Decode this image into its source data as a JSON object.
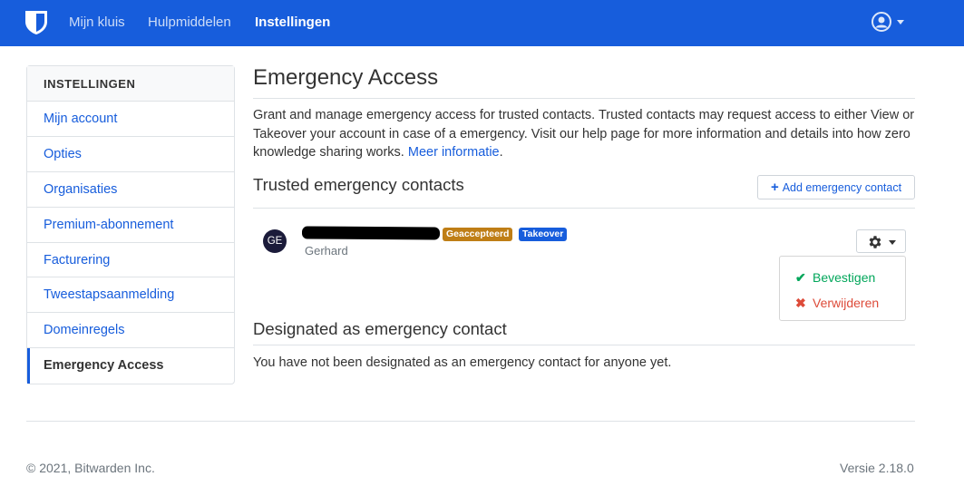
{
  "nav": {
    "items": [
      {
        "label": "Mijn kluis"
      },
      {
        "label": "Hulpmiddelen"
      },
      {
        "label": "Instellingen"
      }
    ]
  },
  "sidebar": {
    "header": "INSTELLINGEN",
    "items": [
      {
        "label": "Mijn account"
      },
      {
        "label": "Opties"
      },
      {
        "label": "Organisaties"
      },
      {
        "label": "Premium-abonnement"
      },
      {
        "label": "Facturering"
      },
      {
        "label": "Tweestapsaanmelding"
      },
      {
        "label": "Domeinregels"
      },
      {
        "label": "Emergency Access"
      }
    ]
  },
  "main": {
    "title": "Emergency Access",
    "description": "Grant and manage emergency access for trusted contacts. Trusted contacts may request access to either View or Takeover your account in case of a emergency. Visit our help page for more information and details into how zero knowledge sharing works.",
    "more_info_link": "Meer informatie",
    "trusted": {
      "title": "Trusted emergency contacts",
      "add_button": "Add emergency contact",
      "contacts": [
        {
          "initials": "GE",
          "name": "Gerhard",
          "status_badge": "Geaccepteerd",
          "type_badge": "Takeover"
        }
      ],
      "menu": {
        "confirm": "Bevestigen",
        "delete": "Verwijderen"
      }
    },
    "designated": {
      "title": "Designated as emergency contact",
      "empty_text": "You have not been designated as an emergency contact for anyone yet."
    }
  },
  "footer": {
    "copyright": "© 2021, Bitwarden Inc.",
    "version": "Versie 2.18.0"
  },
  "colors": {
    "brand": "#175ddc",
    "badge_accepted": "#bf7e16",
    "badge_takeover": "#175ddc",
    "success": "#00a65a",
    "danger": "#dd4b39"
  }
}
